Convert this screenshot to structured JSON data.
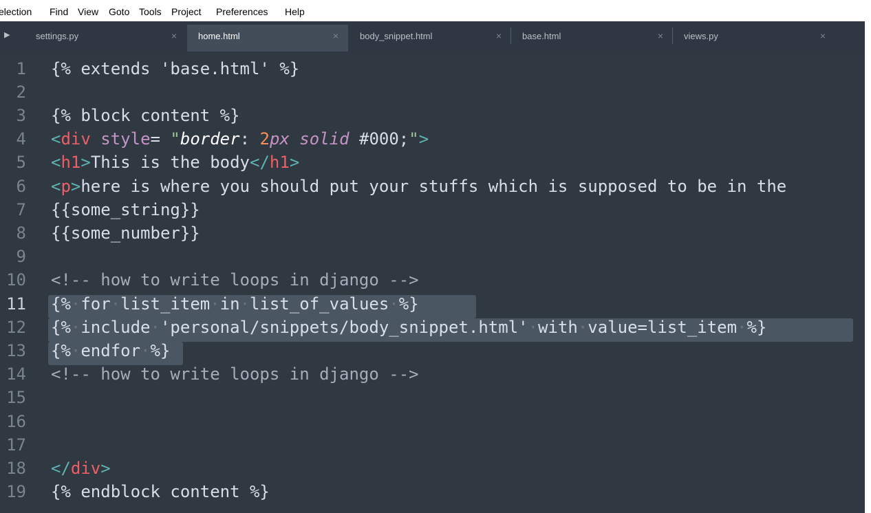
{
  "menu": [
    "election",
    "Find",
    "View",
    "Goto",
    "Tools",
    "Project",
    "Preferences",
    "Help"
  ],
  "tabs": [
    {
      "label": "settings.py",
      "close": "×"
    },
    {
      "label": "home.html",
      "close": "×"
    },
    {
      "label": "body_snippet.html",
      "close": "×"
    },
    {
      "label": "base.html",
      "close": "×"
    },
    {
      "label": "views.py",
      "close": "×"
    }
  ],
  "line_numbers": [
    "1",
    "2",
    "3",
    "4",
    "5",
    "6",
    "7",
    "8",
    "9",
    "10",
    "11",
    "12",
    "13",
    "14",
    "15",
    "16",
    "17",
    "18",
    "19"
  ],
  "code": {
    "l1": "{% extends 'base.html' %}",
    "l3": "{% block content %}",
    "l4": {
      "lt": "<",
      "div": "div",
      "attr": "style",
      "eq": "= ",
      "q1": "\"",
      "prop": "border",
      "colon": ": ",
      "num": "2",
      "unit": "px",
      "sp": " ",
      "kw": "solid",
      "hex": " #000",
      "semi": ";",
      "q2": "\"",
      "gt": ">"
    },
    "l5": {
      "lt1": "<",
      "tag1": "h1",
      "gt1": ">",
      "text": "This is the body",
      "lt2": "</",
      "tag2": "h1",
      "gt2": ">"
    },
    "l6": {
      "lt": "<",
      "tag": "p",
      "gt": ">",
      "text": "here is where you should put your stuffs which is supposed to be in the"
    },
    "l7": "{{some_string}}",
    "l8": "{{some_number}}",
    "l10": "<!-- how to write loops in django -->",
    "l11": [
      "{%",
      "·",
      "for",
      "·",
      "list_item",
      "·",
      "in",
      "·",
      "list_of_values",
      "·",
      "%}"
    ],
    "l12": [
      "{%",
      "·",
      "include",
      "·",
      "'personal/snippets/body_snippet.html'",
      "·",
      "with",
      "·",
      "value=list_item",
      "·",
      "%}"
    ],
    "l13": [
      "{%",
      "·",
      "endfor",
      "·",
      "%}"
    ],
    "l14": "<!-- how to write loops in django -->",
    "l18": {
      "lt": "</",
      "tag": "div",
      "gt": ">"
    },
    "l19": "{% endblock content %}"
  },
  "colors": {
    "editor_bg": "#303841",
    "tab_bg": "#2f3842",
    "tab_active_bg": "#434d59",
    "selection": "#4b5663",
    "tag": "#ec5f67",
    "string": "#99c794",
    "attribute": "#c594c5",
    "number": "#f99157",
    "punctuation": "#5fb3b3"
  }
}
